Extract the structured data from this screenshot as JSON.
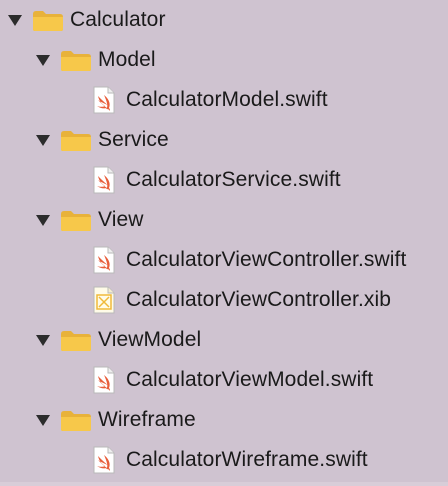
{
  "navigator": {
    "root": {
      "label": "Calculator",
      "icon": "folder-icon"
    },
    "groups": [
      {
        "label": "Model",
        "icon": "folder-icon",
        "files": [
          {
            "label": "CalculatorModel.swift",
            "icon": "swift-file-icon"
          }
        ]
      },
      {
        "label": "Service",
        "icon": "folder-icon",
        "files": [
          {
            "label": "CalculatorService.swift",
            "icon": "swift-file-icon"
          }
        ]
      },
      {
        "label": "View",
        "icon": "folder-icon",
        "files": [
          {
            "label": "CalculatorViewController.swift",
            "icon": "swift-file-icon"
          },
          {
            "label": "CalculatorViewController.xib",
            "icon": "xib-file-icon"
          }
        ]
      },
      {
        "label": "ViewModel",
        "icon": "folder-icon",
        "files": [
          {
            "label": "CalculatorViewModel.swift",
            "icon": "swift-file-icon"
          }
        ]
      },
      {
        "label": "Wireframe",
        "icon": "folder-icon",
        "files": [
          {
            "label": "CalculatorWireframe.swift",
            "icon": "swift-file-icon"
          }
        ]
      }
    ]
  },
  "colors": {
    "background": "#cfc3d0",
    "folder": "#f7c84a",
    "swift_accent": "#e85d3a",
    "xib_accent": "#f0b93a"
  }
}
